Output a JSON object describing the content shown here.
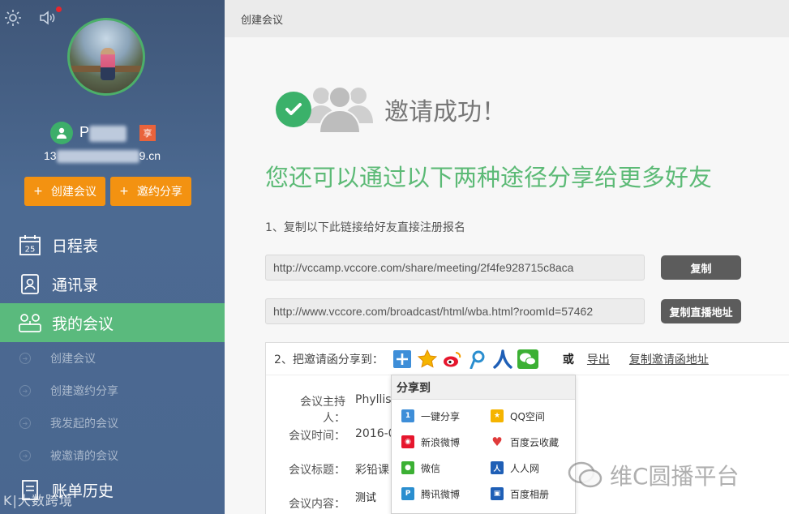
{
  "sidebar": {
    "user": {
      "name_visible": "P",
      "name_tail": "",
      "badge": "享",
      "email_prefix": "13",
      "email_suffix": "9.cn"
    },
    "create_button": "创建会议",
    "invite_button": "邀约分享",
    "nav": [
      {
        "label": "日程表",
        "icon": "calendar-icon",
        "calendar_day": "25"
      },
      {
        "label": "通讯录",
        "icon": "contacts-icon"
      },
      {
        "label": "我的会议",
        "icon": "meetings-icon"
      }
    ],
    "sub_items": [
      "创建会议",
      "创建邀约分享",
      "我发起的会议",
      "被邀请的会议"
    ],
    "bottom_item": "账单历史",
    "watermark": "K|大数跨境"
  },
  "header": {
    "breadcrumb": "创建会议"
  },
  "main": {
    "success_text": "邀请成功！",
    "share_heading": "您还可以通过以下两种途径分享给更多好友",
    "step1": "1、复制以下此链接给好友直接注册报名",
    "link1": "http://vccamp.vccore.com/share/meeting/2f4fe928715c8aca",
    "copy_button": "复制",
    "link2": "http://www.vccore.com/broadcast/html/wba.html?roomId=57462",
    "copy_broadcast_button": "复制直播地址",
    "step2": "2、把邀请函分享到：",
    "or": "或",
    "export": "导出",
    "copy_invite": "复制邀请函地址",
    "form": [
      {
        "label": "会议主持人：",
        "value": "Phyllis"
      },
      {
        "label": "会议时间：",
        "value": "2016-0"
      },
      {
        "label": "会议标题：",
        "value": "彩铅课"
      },
      {
        "label": "会议内容：",
        "value": "测试"
      }
    ]
  },
  "dropdown": {
    "title": "分享到",
    "items": [
      "一键分享",
      "QQ空间",
      "新浪微博",
      "百度云收藏",
      "微信",
      "人人网",
      "腾讯微博",
      "百度相册"
    ]
  },
  "watermark_right": "维C圆播平台",
  "colors": {
    "sidebar": "#4a6790",
    "accent_green": "#5aba7d",
    "orange": "#f39211",
    "heading_green": "#5cba76"
  }
}
